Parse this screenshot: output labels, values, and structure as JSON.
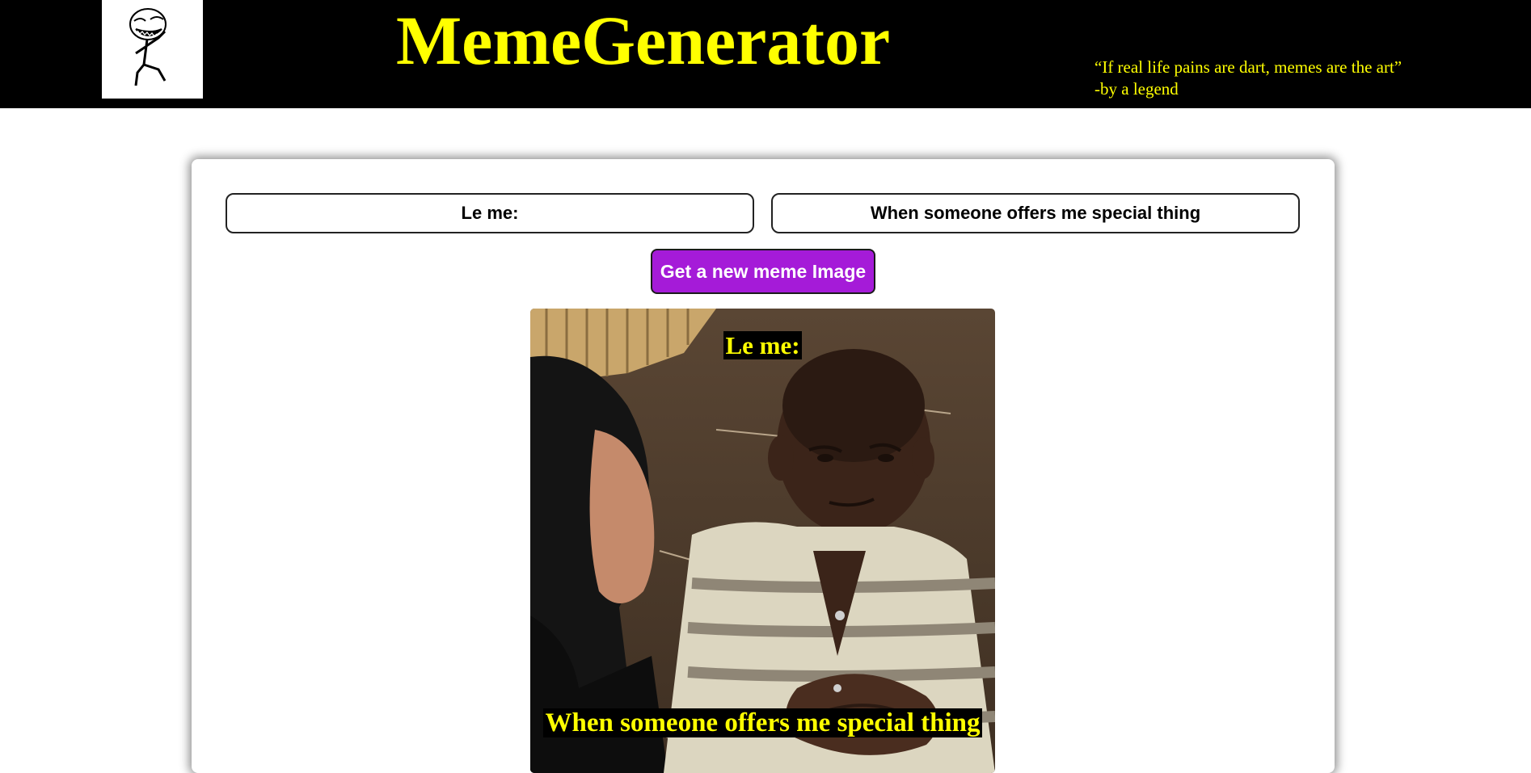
{
  "header": {
    "logo_icon": "trollface-stickman-icon",
    "title": "MemeGenerator",
    "quote_line1": "“If real life pains are dart, memes are the art”",
    "quote_line2": "-by a legend",
    "background": "#000000",
    "accent": "#ffff00"
  },
  "form": {
    "top_text_value": "Le me:",
    "bottom_text_value": "When someone offers me special thing",
    "button_label": "Get a new meme Image",
    "button_color": "#a51bd8"
  },
  "meme": {
    "image_subject": "skeptical-child-photo",
    "top_caption": "Le me:",
    "bottom_caption": "When someone offers me special thing"
  }
}
